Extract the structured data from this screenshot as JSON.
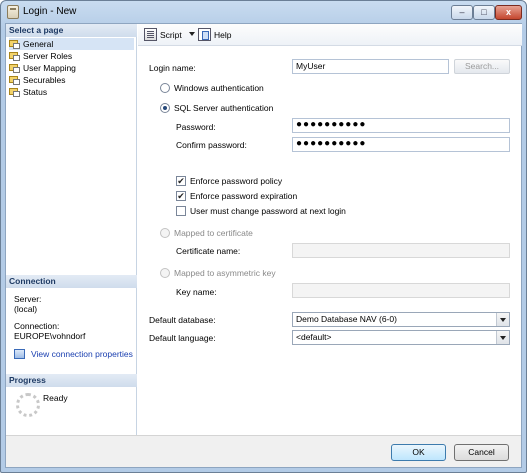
{
  "window": {
    "title": "Login - New",
    "min_glyph": "–",
    "max_glyph": "□",
    "close_glyph": "x"
  },
  "sidebar": {
    "header": "Select a page",
    "items": [
      {
        "label": "General",
        "selected": true
      },
      {
        "label": "Server Roles"
      },
      {
        "label": "User Mapping"
      },
      {
        "label": "Securables"
      },
      {
        "label": "Status"
      }
    ],
    "connection": {
      "header": "Connection",
      "server_label": "Server:",
      "server_value": "(local)",
      "conn_label": "Connection:",
      "conn_value": "EUROPE\\vohndorf",
      "link": "View connection properties"
    },
    "progress": {
      "header": "Progress",
      "status": "Ready"
    }
  },
  "toolbar": {
    "script_label": "Script",
    "help_label": "Help"
  },
  "form": {
    "login_name_label": "Login name:",
    "login_name_value": "MyUser",
    "search_button": "Search...",
    "windows_auth": "Windows authentication",
    "sql_auth": "SQL Server authentication",
    "password_label": "Password:",
    "password_value": "●●●●●●●●●●",
    "confirm_label": "Confirm password:",
    "confirm_value": "●●●●●●●●●●",
    "enforce_policy": "Enforce password policy",
    "enforce_expiration": "Enforce password expiration",
    "must_change": "User must change password at next login",
    "mapped_cert": "Mapped to certificate",
    "cert_name_label": "Certificate name:",
    "mapped_asym": "Mapped to asymmetric key",
    "key_name_label": "Key name:",
    "default_db_label": "Default database:",
    "default_db_value": "Demo Database NAV (6-0)",
    "default_lang_label": "Default language:",
    "default_lang_value": "<default>",
    "check_glyph": "✔"
  },
  "buttons": {
    "ok": "OK",
    "cancel": "Cancel"
  },
  "colors": {
    "header_text": "#1f3b64",
    "link": "#1a3fb0",
    "title_bar": "#b3cbe6"
  }
}
